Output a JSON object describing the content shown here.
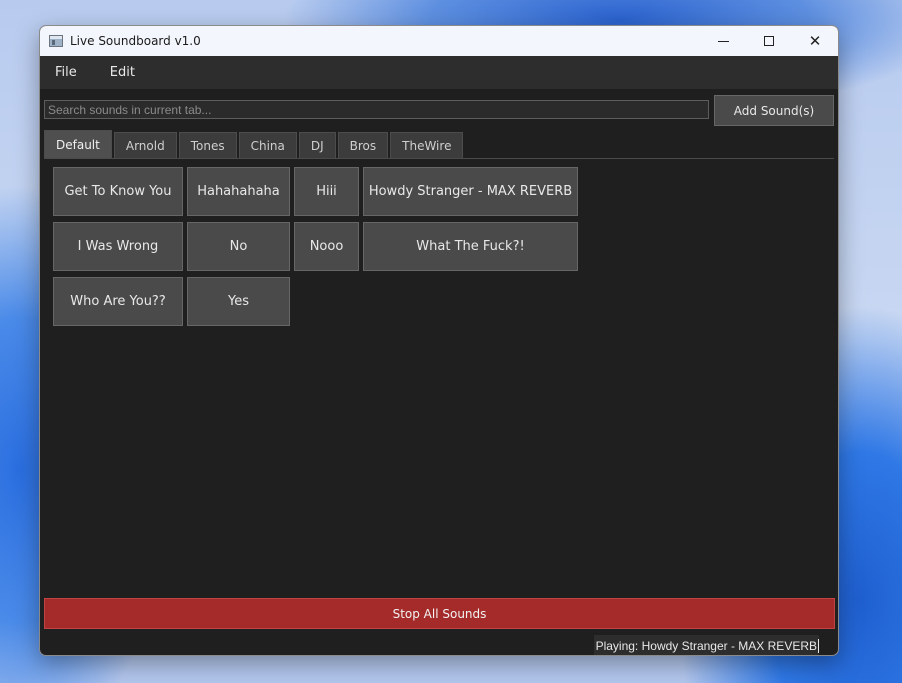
{
  "window": {
    "title": "Live Soundboard v1.0"
  },
  "menu": {
    "items": [
      "File",
      "Edit"
    ]
  },
  "search": {
    "placeholder": "Search sounds in current tab..."
  },
  "toolbar": {
    "add_label": "Add Sound(s)"
  },
  "tabs": [
    {
      "label": "Default",
      "active": true
    },
    {
      "label": "Arnold"
    },
    {
      "label": "Tones"
    },
    {
      "label": "China"
    },
    {
      "label": "DJ"
    },
    {
      "label": "Bros"
    },
    {
      "label": "TheWire"
    }
  ],
  "sounds": [
    [
      "Get To Know You",
      "Hahahahaha",
      "Hiii",
      "Howdy Stranger - MAX REVERB"
    ],
    [
      "I Was Wrong",
      "No",
      "Nooo",
      "What The Fuck?!"
    ],
    [
      "Who Are You??",
      "Yes"
    ]
  ],
  "footer": {
    "stop_label": "Stop All Sounds",
    "status": "Playing: Howdy Stranger - MAX REVERB"
  },
  "colors": {
    "background": "#1f1f1f",
    "button": "#4a4a4a",
    "stop": "#a52b2b"
  }
}
